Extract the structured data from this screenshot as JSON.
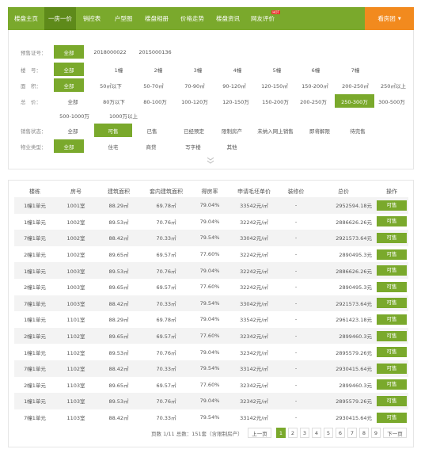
{
  "nav": {
    "items": [
      "楼盘主页",
      "一房一价",
      "销控表",
      "户型图",
      "楼盘相册",
      "价格走势",
      "楼盘资讯",
      "网友评价"
    ],
    "hot_badge": "HOT",
    "cta": "看房团",
    "accent": "#7aa92c",
    "cta_color": "#f28a1e"
  },
  "filters": {
    "presale": {
      "label": "预售证号：",
      "options": [
        "全部",
        "2018000022",
        "2015000136"
      ],
      "selected": "全部"
    },
    "building": {
      "label": "楼　号：",
      "options": [
        "全部",
        "1幢",
        "2幢",
        "3幢",
        "4幢",
        "5幢",
        "6幢",
        "7幢"
      ],
      "selected": "全部"
    },
    "area": {
      "label": "面　积：",
      "options": [
        "全部",
        "50㎡以下",
        "50-70㎡",
        "70-90㎡",
        "90-120㎡",
        "120-150㎡",
        "150-200㎡",
        "200-250㎡",
        "250㎡以上"
      ],
      "selected": "全部"
    },
    "total": {
      "label": "总　价：",
      "options": [
        "全部",
        "80万以下",
        "80-100万",
        "100-120万",
        "120-150万",
        "150-200万",
        "200-250万",
        "250-300万",
        "300-500万",
        "500-1000万",
        "1000万以上"
      ],
      "selected": "250-300万"
    },
    "status": {
      "label": "销售状态：",
      "options": [
        "全部",
        "可售",
        "已售",
        "已经预定",
        "限制房产",
        "未纳入网上销售",
        "即将解限",
        "待完售"
      ],
      "selected": "可售"
    },
    "type": {
      "label": "物业类型：",
      "options": [
        "全部",
        "住宅",
        "商贷",
        "写字楼",
        "其他"
      ],
      "selected": "全部"
    },
    "expand_icon": "chevron-down-double"
  },
  "table": {
    "headers": [
      "楼栋",
      "房号",
      "建筑面积",
      "套内建筑面积",
      "得房率",
      "申请毛坯单价",
      "装修价",
      "总价",
      "操作"
    ],
    "rows": [
      [
        "1幢1单元",
        "1001室",
        "88.29㎡",
        "69.78㎡",
        "79.04%",
        "33542元/㎡",
        "-",
        "2952594.18元",
        "可售"
      ],
      [
        "1幢1单元",
        "1002室",
        "89.53㎡",
        "70.76㎡",
        "79.04%",
        "32242元/㎡",
        "-",
        "2886626.26元",
        "可售"
      ],
      [
        "7幢1单元",
        "1002室",
        "88.42㎡",
        "70.33㎡",
        "79.54%",
        "33042元/㎡",
        "-",
        "2921573.64元",
        "可售"
      ],
      [
        "2幢1单元",
        "1002室",
        "89.65㎡",
        "69.57㎡",
        "77.60%",
        "32242元/㎡",
        "-",
        "2890495.3元",
        "可售"
      ],
      [
        "1幢1单元",
        "1003室",
        "89.53㎡",
        "70.76㎡",
        "79.04%",
        "32242元/㎡",
        "-",
        "2886626.26元",
        "可售"
      ],
      [
        "2幢1单元",
        "1003室",
        "89.65㎡",
        "69.57㎡",
        "77.60%",
        "32242元/㎡",
        "-",
        "2890495.3元",
        "可售"
      ],
      [
        "7幢1单元",
        "1003室",
        "88.42㎡",
        "70.33㎡",
        "79.54%",
        "33042元/㎡",
        "-",
        "2921573.64元",
        "可售"
      ],
      [
        "1幢1单元",
        "1101室",
        "88.29㎡",
        "69.78㎡",
        "79.04%",
        "33542元/㎡",
        "-",
        "2961423.18元",
        "可售"
      ],
      [
        "2幢1单元",
        "1102室",
        "89.65㎡",
        "69.57㎡",
        "77.60%",
        "32342元/㎡",
        "-",
        "2899460.3元",
        "可售"
      ],
      [
        "1幢1单元",
        "1102室",
        "89.53㎡",
        "70.76㎡",
        "79.04%",
        "32342元/㎡",
        "-",
        "2895579.26元",
        "可售"
      ],
      [
        "7幢1单元",
        "1102室",
        "88.42㎡",
        "70.33㎡",
        "79.54%",
        "33142元/㎡",
        "-",
        "2930415.64元",
        "可售"
      ],
      [
        "2幢1单元",
        "1103室",
        "89.65㎡",
        "69.57㎡",
        "77.60%",
        "32342元/㎡",
        "-",
        "2899460.3元",
        "可售"
      ],
      [
        "1幢1单元",
        "1103室",
        "89.53㎡",
        "70.76㎡",
        "79.04%",
        "32342元/㎡",
        "-",
        "2895579.26元",
        "可售"
      ],
      [
        "7幢1单元",
        "1103室",
        "88.42㎡",
        "70.33㎡",
        "79.54%",
        "33142元/㎡",
        "-",
        "2930415.64元",
        "可售"
      ]
    ]
  },
  "pagination": {
    "info": "页数 1/11 总数：151套（含限制房产）",
    "prev": "上一页",
    "next": "下一页",
    "pages": [
      "1",
      "2",
      "3",
      "4",
      "5",
      "6",
      "7",
      "8",
      "9"
    ],
    "current": "1"
  }
}
